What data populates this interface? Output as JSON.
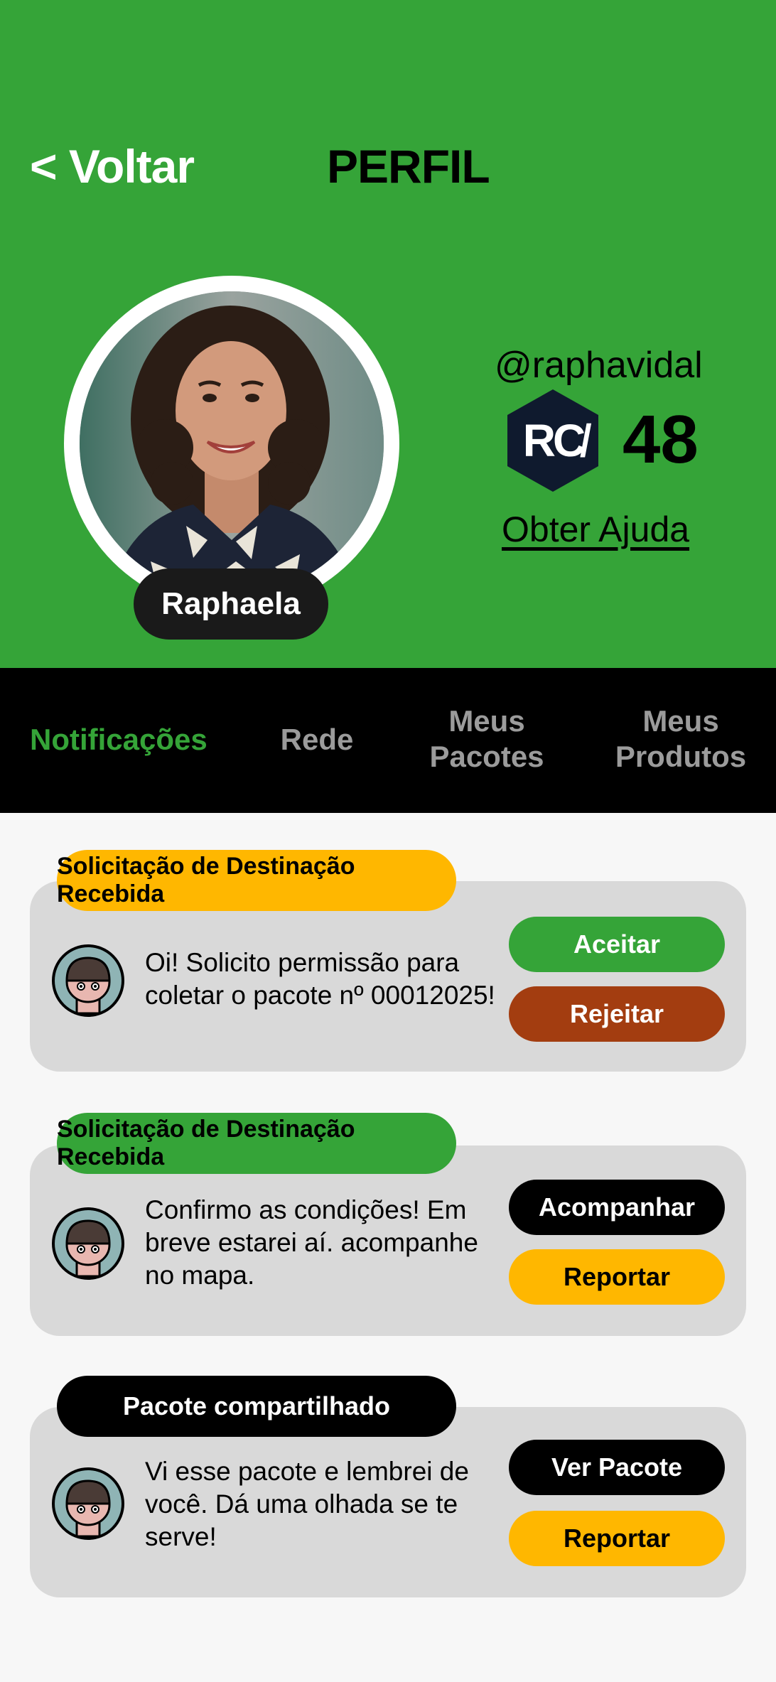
{
  "header": {
    "back_label": "< Voltar",
    "title": "PERFIL"
  },
  "profile": {
    "name": "Raphaela",
    "handle": "@raphavidal",
    "coin_symbol": "RC̸",
    "balance": "48",
    "help_label": "Obter Ajuda"
  },
  "tabs": [
    {
      "label": "Notificações",
      "active": true
    },
    {
      "label": "Rede",
      "active": false
    },
    {
      "label": "Meus Pacotes",
      "active": false
    },
    {
      "label": "Meus Produtos",
      "active": false
    }
  ],
  "notifications": [
    {
      "title": "Solicitação de Destinação Recebida",
      "title_bg": "#ffb700",
      "message": "Oi! Solicito permissão para coletar o pacote nº 00012025!",
      "actions": [
        {
          "label": "Aceitar",
          "bg": "#35a438",
          "color": "#ffffff"
        },
        {
          "label": "Rejeitar",
          "bg": "#a33d10",
          "color": "#ffffff"
        }
      ]
    },
    {
      "title": "Solicitação de Destinação Recebida",
      "title_bg": "#35a438",
      "message": "Confirmo as condições! Em breve estarei aí. acompanhe no mapa.",
      "actions": [
        {
          "label": "Acompanhar",
          "bg": "#000000",
          "color": "#ffffff"
        },
        {
          "label": "Reportar",
          "bg": "#ffb700",
          "color": "#000000"
        }
      ]
    },
    {
      "title": "Pacote compartilhado",
      "title_bg": "#000000",
      "message": "Vi esse pacote e lembrei de você. Dá uma olhada se te serve!",
      "actions": [
        {
          "label": "Ver Pacote",
          "bg": "#000000",
          "color": "#ffffff"
        },
        {
          "label": "Reportar",
          "bg": "#ffb700",
          "color": "#000000"
        }
      ]
    }
  ],
  "colors": {
    "brand_green": "#35a438",
    "amber": "#ffb700",
    "rust": "#a33d10"
  }
}
